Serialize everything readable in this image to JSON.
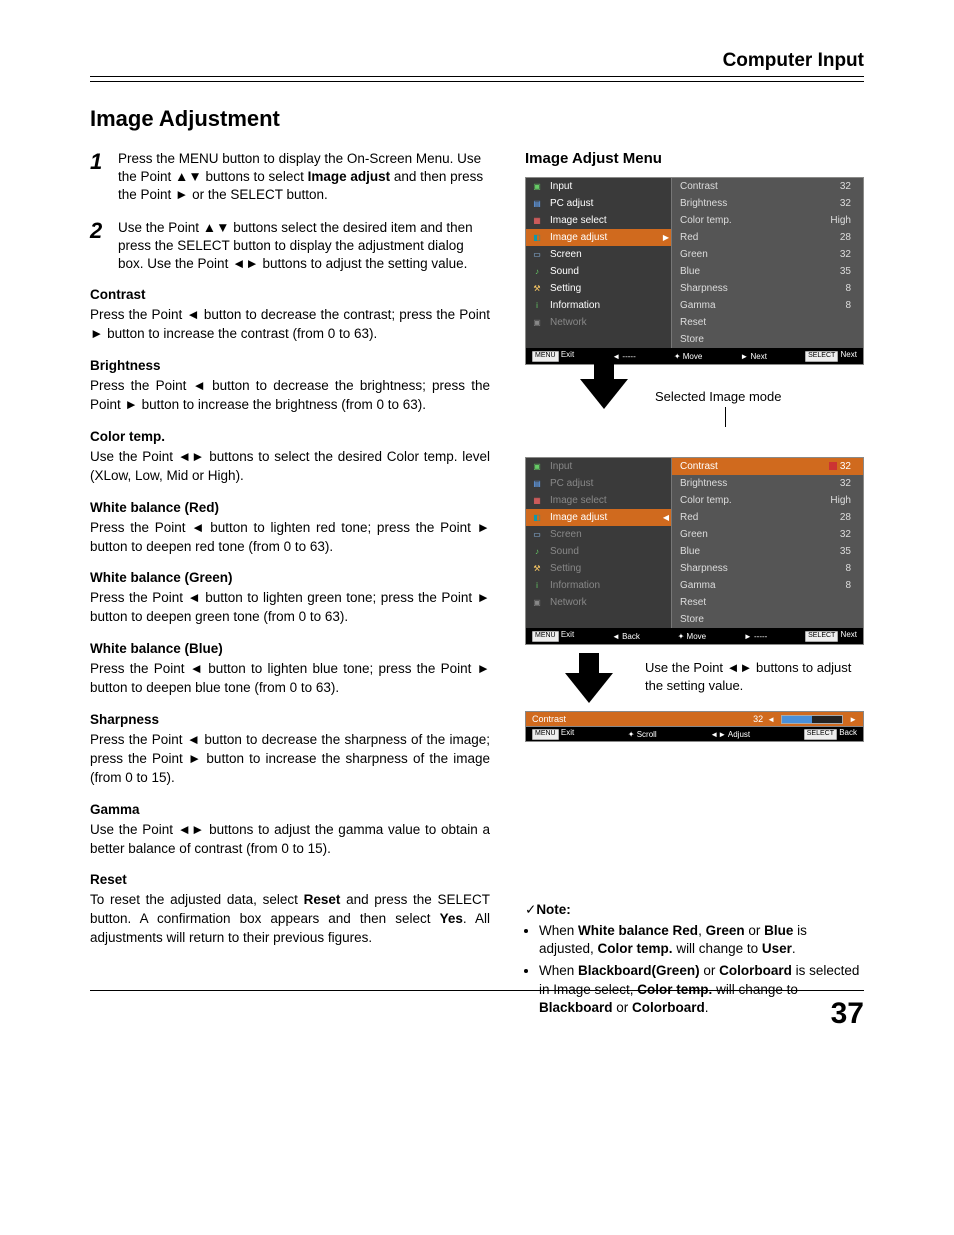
{
  "header": "Computer Input",
  "title": "Image Adjustment",
  "steps": [
    {
      "num": "1",
      "pre": "Press the MENU button to display the On-Screen Menu. Use the Point ▲▼ buttons to select ",
      "bold": "Image adjust",
      "post": " and then press the Point ► or the SELECT button."
    },
    {
      "num": "2",
      "pre": "Use the Point ▲▼ buttons select the desired item and then press the SELECT button to display the adjustment dialog box. Use the Point ◄► buttons to adjust the setting value.",
      "bold": "",
      "post": ""
    }
  ],
  "sections": [
    {
      "h": "Contrast",
      "p": "Press the Point ◄ button to decrease the contrast; press the Point ► button to increase the contrast (from 0 to 63)."
    },
    {
      "h": "Brightness",
      "p": "Press the Point ◄ button to decrease the brightness; press the Point ► button to increase the brightness (from 0 to 63)."
    },
    {
      "h": "Color temp.",
      "p": "Use the Point ◄► buttons to select the desired Color temp. level (XLow, Low, Mid or High)."
    },
    {
      "h": "White balance (Red)",
      "p": "Press the Point ◄ button to lighten red tone; press the Point ► button to deepen red tone (from 0 to 63)."
    },
    {
      "h": "White balance (Green)",
      "p": "Press the Point ◄ button to lighten green tone; press the Point ► button to deepen green tone (from 0 to 63)."
    },
    {
      "h": "White balance (Blue)",
      "p": "Press the Point ◄ button to lighten blue tone; press the Point ► button to deepen blue tone (from 0 to 63)."
    },
    {
      "h": "Sharpness",
      "p": "Press the Point ◄ button to decrease the sharpness of the image; press the Point ► button to increase the sharpness of the image (from 0 to 15)."
    },
    {
      "h": "Gamma",
      "p": "Use the Point ◄► buttons to adjust the gamma value to obtain a better balance of contrast (from 0 to 15)."
    },
    {
      "h": "Reset",
      "p_html": "To reset the adjusted data, select <b>Reset</b> and press the SELECT button. A confirmation box appears and then select <b>Yes</b>. All adjustments will return to their previous figures."
    }
  ],
  "right_title": "Image Adjust Menu",
  "osd1": {
    "left": [
      {
        "label": "Input",
        "icon": "▣",
        "color": "#6c6"
      },
      {
        "label": "PC adjust",
        "icon": "▤",
        "color": "#6af"
      },
      {
        "label": "Image select",
        "icon": "▦",
        "color": "#f66"
      },
      {
        "label": "Image adjust",
        "icon": "◧",
        "color": "#19a",
        "selected": true
      },
      {
        "label": "Screen",
        "icon": "▭",
        "color": "#9cf"
      },
      {
        "label": "Sound",
        "icon": "♪",
        "color": "#6c6"
      },
      {
        "label": "Setting",
        "icon": "⚒",
        "color": "#fc6"
      },
      {
        "label": "Information",
        "icon": "i",
        "color": "#6c6"
      },
      {
        "label": "Network",
        "icon": "▣",
        "color": "#888",
        "dim": true
      }
    ],
    "right": [
      {
        "label": "Contrast",
        "val": "32"
      },
      {
        "label": "Brightness",
        "val": "32"
      },
      {
        "label": "Color temp.",
        "val": "High"
      },
      {
        "label": "Red",
        "val": "28"
      },
      {
        "label": "Green",
        "val": "32"
      },
      {
        "label": "Blue",
        "val": "35"
      },
      {
        "label": "Sharpness",
        "val": "8"
      },
      {
        "label": "Gamma",
        "val": "8"
      },
      {
        "label": "Reset",
        "val": ""
      },
      {
        "label": "Store",
        "val": ""
      }
    ],
    "footer": {
      "exit": "Exit",
      "back": "◄ -----",
      "move": "✦ Move",
      "next": "► Next",
      "select": "Next"
    }
  },
  "sel_caption": "Selected Image mode",
  "osd2": {
    "left": [
      {
        "label": "Input",
        "icon": "▣",
        "color": "#6c6",
        "dim": true
      },
      {
        "label": "PC adjust",
        "icon": "▤",
        "color": "#6af",
        "dim": true
      },
      {
        "label": "Image select",
        "icon": "▦",
        "color": "#f66",
        "dim": true
      },
      {
        "label": "Image adjust",
        "icon": "◧",
        "color": "#19a",
        "selected": true
      },
      {
        "label": "Screen",
        "icon": "▭",
        "color": "#9cf",
        "dim": true
      },
      {
        "label": "Sound",
        "icon": "♪",
        "color": "#6c6",
        "dim": true
      },
      {
        "label": "Setting",
        "icon": "⚒",
        "color": "#fc6",
        "dim": true
      },
      {
        "label": "Information",
        "icon": "i",
        "color": "#6c6",
        "dim": true
      },
      {
        "label": "Network",
        "icon": "▣",
        "color": "#888",
        "dim": true
      }
    ],
    "right": [
      {
        "label": "Contrast",
        "val": "32",
        "selected": true,
        "indicator": true
      },
      {
        "label": "Brightness",
        "val": "32"
      },
      {
        "label": "Color temp.",
        "val": "High"
      },
      {
        "label": "Red",
        "val": "28"
      },
      {
        "label": "Green",
        "val": "32"
      },
      {
        "label": "Blue",
        "val": "35"
      },
      {
        "label": "Sharpness",
        "val": "8"
      },
      {
        "label": "Gamma",
        "val": "8"
      },
      {
        "label": "Reset",
        "val": ""
      },
      {
        "label": "Store",
        "val": ""
      }
    ],
    "footer": {
      "exit": "Exit",
      "back": "◄ Back",
      "move": "✦ Move",
      "next": "► -----",
      "select": "Next"
    },
    "chevron_left": true
  },
  "caption2": "Use the Point ◄► buttons to adjust the setting value.",
  "slider": {
    "label": "Contrast",
    "val": "32"
  },
  "slider_footer": {
    "exit": "Exit",
    "scroll": "✦ Scroll",
    "adjust": "◄► Adjust",
    "back": "Back"
  },
  "note": {
    "heading": "Note:",
    "items": [
      "When <b>White balance Red</b>, <b>Green</b> or <b>Blue</b> is adjusted, <b>Color temp.</b> will change to <b>User</b>.",
      "When <b>Blackboard(Green)</b> or <b>Colorboard</b> is selected in Image select, <b>Color temp.</b> will change to <b>Blackboard</b> or <b>Colorboard</b>."
    ]
  },
  "page_number": "37"
}
